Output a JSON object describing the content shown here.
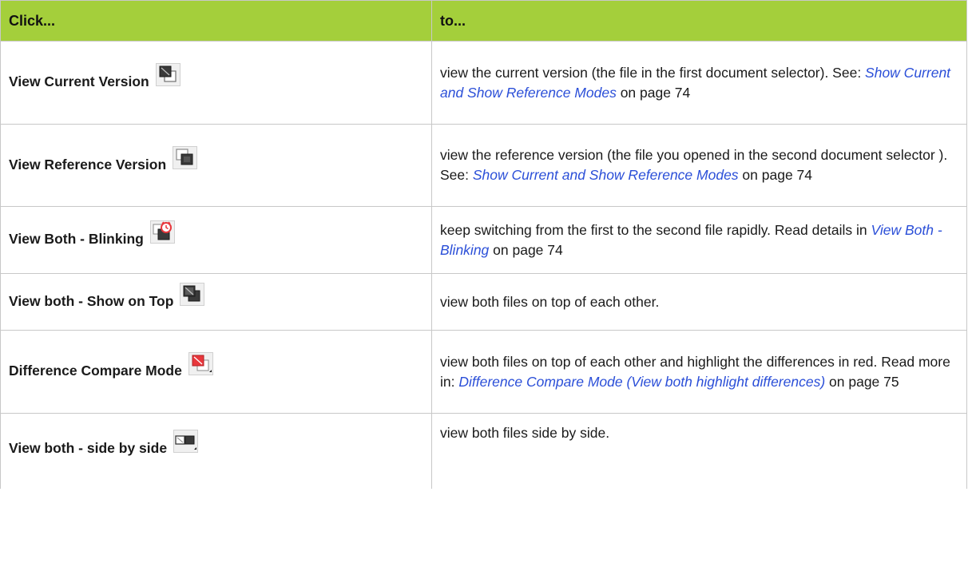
{
  "header": {
    "col1": "Click...",
    "col2": "to..."
  },
  "rows": [
    {
      "label": "View Current Version",
      "icon": "view-current-version-icon",
      "text_before": "view the current version (the file in the first document selector). See: ",
      "link": "Show Current and Show Reference Modes",
      "text_after": " on page 74"
    },
    {
      "label": "View Reference Version",
      "icon": "view-reference-version-icon",
      "text_before": "view the reference version (the file you opened in the second document selector ). See: ",
      "link": "Show Current and Show Reference Modes",
      "text_after": " on page 74"
    },
    {
      "label": "View Both - Blinking",
      "icon": "view-both-blinking-icon",
      "text_before": "keep switching from the first to the second file rapidly. Read details in ",
      "link": "View Both - Blinking",
      "text_after": " on page 74"
    },
    {
      "label": "View both - Show on Top",
      "icon": "view-both-show-on-top-icon",
      "text_before": "view both files on top of each other.",
      "link": "",
      "text_after": ""
    },
    {
      "label": "Difference Compare Mode",
      "icon": "difference-compare-mode-icon",
      "text_before": "view both files on top of each other and highlight the differences in red. Read more in: ",
      "link": "Difference Compare Mode (View both highlight differences)",
      "text_after": " on page 75"
    },
    {
      "label": "View both - side by side",
      "icon": "view-both-side-by-side-icon",
      "text_before": "view both files side by side.",
      "link": "",
      "text_after": ""
    }
  ],
  "colors": {
    "header_bg": "#a4cf3b",
    "link": "#2b4fd8",
    "diff_red": "#e8373c"
  }
}
